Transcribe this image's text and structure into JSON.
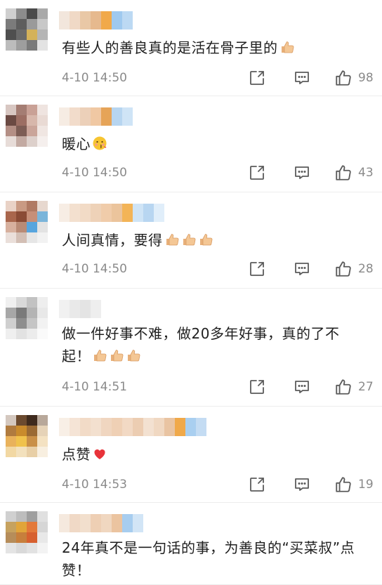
{
  "comments": [
    {
      "text": "有些人的善良真的是活在骨子里的",
      "emoji": [
        "thumbs-up-icon"
      ],
      "time": "4-10 14:50",
      "likes": "98"
    },
    {
      "text": "暖心",
      "emoji": [
        "kiss-face-icon"
      ],
      "time": "4-10 14:50",
      "likes": "43"
    },
    {
      "text": "人间真情，要得",
      "emoji": [
        "thumbs-up-icon",
        "thumbs-up-icon",
        "thumbs-up-icon"
      ],
      "time": "4-10 14:50",
      "likes": "28"
    },
    {
      "text": "做一件好事不难，做20多年好事，真的了不起！",
      "emoji": [
        "thumbs-up-icon",
        "thumbs-up-icon",
        "thumbs-up-icon"
      ],
      "time": "4-10 14:51",
      "likes": "27"
    },
    {
      "text": "点赞",
      "emoji": [
        "heart-icon"
      ],
      "time": "4-10 14:53",
      "likes": "19"
    },
    {
      "text": "24年真不是一句话的事，为善良的“买菜叔”点赞！",
      "emoji": [],
      "time": "",
      "likes": ""
    }
  ],
  "colors": {
    "text": "#1f1f1f",
    "meta": "#8a8a8a",
    "divider": "#ededed",
    "icon": "#5b5b5b",
    "thumb": "#f2c28d",
    "heart": "#e8333a"
  }
}
